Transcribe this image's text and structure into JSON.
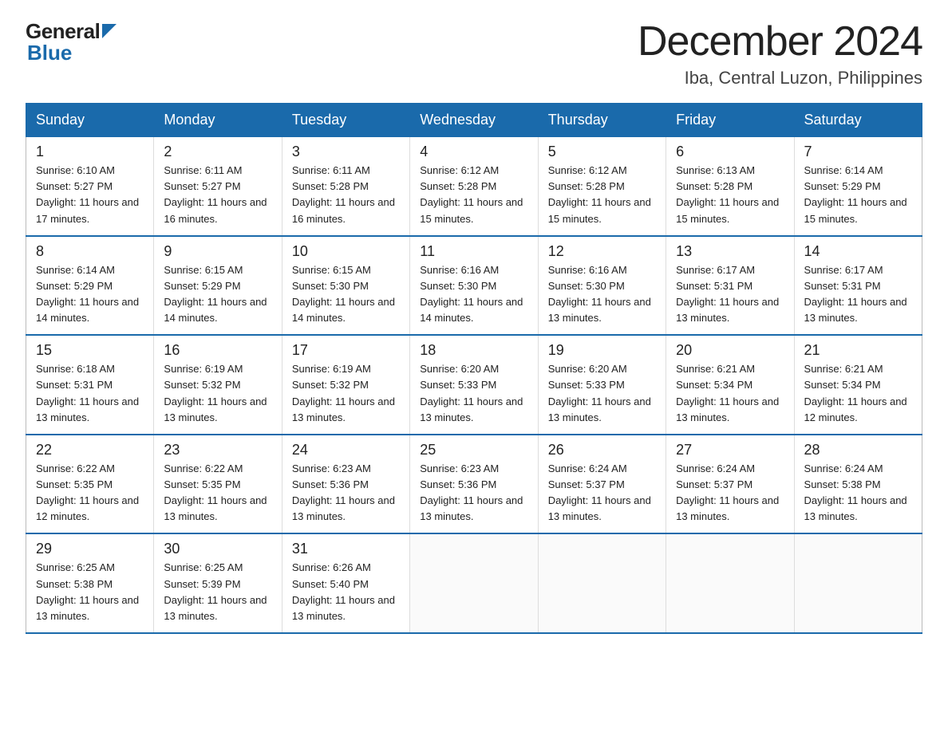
{
  "logo": {
    "general": "General",
    "arrow_color": "#1a6aab",
    "blue": "Blue"
  },
  "header": {
    "title": "December 2024",
    "subtitle": "Iba, Central Luzon, Philippines"
  },
  "days_of_week": [
    "Sunday",
    "Monday",
    "Tuesday",
    "Wednesday",
    "Thursday",
    "Friday",
    "Saturday"
  ],
  "weeks": [
    [
      {
        "day": "1",
        "sunrise": "Sunrise: 6:10 AM",
        "sunset": "Sunset: 5:27 PM",
        "daylight": "Daylight: 11 hours and 17 minutes."
      },
      {
        "day": "2",
        "sunrise": "Sunrise: 6:11 AM",
        "sunset": "Sunset: 5:27 PM",
        "daylight": "Daylight: 11 hours and 16 minutes."
      },
      {
        "day": "3",
        "sunrise": "Sunrise: 6:11 AM",
        "sunset": "Sunset: 5:28 PM",
        "daylight": "Daylight: 11 hours and 16 minutes."
      },
      {
        "day": "4",
        "sunrise": "Sunrise: 6:12 AM",
        "sunset": "Sunset: 5:28 PM",
        "daylight": "Daylight: 11 hours and 15 minutes."
      },
      {
        "day": "5",
        "sunrise": "Sunrise: 6:12 AM",
        "sunset": "Sunset: 5:28 PM",
        "daylight": "Daylight: 11 hours and 15 minutes."
      },
      {
        "day": "6",
        "sunrise": "Sunrise: 6:13 AM",
        "sunset": "Sunset: 5:28 PM",
        "daylight": "Daylight: 11 hours and 15 minutes."
      },
      {
        "day": "7",
        "sunrise": "Sunrise: 6:14 AM",
        "sunset": "Sunset: 5:29 PM",
        "daylight": "Daylight: 11 hours and 15 minutes."
      }
    ],
    [
      {
        "day": "8",
        "sunrise": "Sunrise: 6:14 AM",
        "sunset": "Sunset: 5:29 PM",
        "daylight": "Daylight: 11 hours and 14 minutes."
      },
      {
        "day": "9",
        "sunrise": "Sunrise: 6:15 AM",
        "sunset": "Sunset: 5:29 PM",
        "daylight": "Daylight: 11 hours and 14 minutes."
      },
      {
        "day": "10",
        "sunrise": "Sunrise: 6:15 AM",
        "sunset": "Sunset: 5:30 PM",
        "daylight": "Daylight: 11 hours and 14 minutes."
      },
      {
        "day": "11",
        "sunrise": "Sunrise: 6:16 AM",
        "sunset": "Sunset: 5:30 PM",
        "daylight": "Daylight: 11 hours and 14 minutes."
      },
      {
        "day": "12",
        "sunrise": "Sunrise: 6:16 AM",
        "sunset": "Sunset: 5:30 PM",
        "daylight": "Daylight: 11 hours and 13 minutes."
      },
      {
        "day": "13",
        "sunrise": "Sunrise: 6:17 AM",
        "sunset": "Sunset: 5:31 PM",
        "daylight": "Daylight: 11 hours and 13 minutes."
      },
      {
        "day": "14",
        "sunrise": "Sunrise: 6:17 AM",
        "sunset": "Sunset: 5:31 PM",
        "daylight": "Daylight: 11 hours and 13 minutes."
      }
    ],
    [
      {
        "day": "15",
        "sunrise": "Sunrise: 6:18 AM",
        "sunset": "Sunset: 5:31 PM",
        "daylight": "Daylight: 11 hours and 13 minutes."
      },
      {
        "day": "16",
        "sunrise": "Sunrise: 6:19 AM",
        "sunset": "Sunset: 5:32 PM",
        "daylight": "Daylight: 11 hours and 13 minutes."
      },
      {
        "day": "17",
        "sunrise": "Sunrise: 6:19 AM",
        "sunset": "Sunset: 5:32 PM",
        "daylight": "Daylight: 11 hours and 13 minutes."
      },
      {
        "day": "18",
        "sunrise": "Sunrise: 6:20 AM",
        "sunset": "Sunset: 5:33 PM",
        "daylight": "Daylight: 11 hours and 13 minutes."
      },
      {
        "day": "19",
        "sunrise": "Sunrise: 6:20 AM",
        "sunset": "Sunset: 5:33 PM",
        "daylight": "Daylight: 11 hours and 13 minutes."
      },
      {
        "day": "20",
        "sunrise": "Sunrise: 6:21 AM",
        "sunset": "Sunset: 5:34 PM",
        "daylight": "Daylight: 11 hours and 13 minutes."
      },
      {
        "day": "21",
        "sunrise": "Sunrise: 6:21 AM",
        "sunset": "Sunset: 5:34 PM",
        "daylight": "Daylight: 11 hours and 12 minutes."
      }
    ],
    [
      {
        "day": "22",
        "sunrise": "Sunrise: 6:22 AM",
        "sunset": "Sunset: 5:35 PM",
        "daylight": "Daylight: 11 hours and 12 minutes."
      },
      {
        "day": "23",
        "sunrise": "Sunrise: 6:22 AM",
        "sunset": "Sunset: 5:35 PM",
        "daylight": "Daylight: 11 hours and 13 minutes."
      },
      {
        "day": "24",
        "sunrise": "Sunrise: 6:23 AM",
        "sunset": "Sunset: 5:36 PM",
        "daylight": "Daylight: 11 hours and 13 minutes."
      },
      {
        "day": "25",
        "sunrise": "Sunrise: 6:23 AM",
        "sunset": "Sunset: 5:36 PM",
        "daylight": "Daylight: 11 hours and 13 minutes."
      },
      {
        "day": "26",
        "sunrise": "Sunrise: 6:24 AM",
        "sunset": "Sunset: 5:37 PM",
        "daylight": "Daylight: 11 hours and 13 minutes."
      },
      {
        "day": "27",
        "sunrise": "Sunrise: 6:24 AM",
        "sunset": "Sunset: 5:37 PM",
        "daylight": "Daylight: 11 hours and 13 minutes."
      },
      {
        "day": "28",
        "sunrise": "Sunrise: 6:24 AM",
        "sunset": "Sunset: 5:38 PM",
        "daylight": "Daylight: 11 hours and 13 minutes."
      }
    ],
    [
      {
        "day": "29",
        "sunrise": "Sunrise: 6:25 AM",
        "sunset": "Sunset: 5:38 PM",
        "daylight": "Daylight: 11 hours and 13 minutes."
      },
      {
        "day": "30",
        "sunrise": "Sunrise: 6:25 AM",
        "sunset": "Sunset: 5:39 PM",
        "daylight": "Daylight: 11 hours and 13 minutes."
      },
      {
        "day": "31",
        "sunrise": "Sunrise: 6:26 AM",
        "sunset": "Sunset: 5:40 PM",
        "daylight": "Daylight: 11 hours and 13 minutes."
      },
      null,
      null,
      null,
      null
    ]
  ]
}
